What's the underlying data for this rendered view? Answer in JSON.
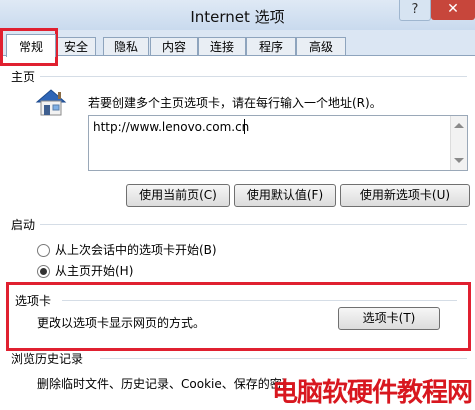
{
  "window": {
    "title": "Internet 选项",
    "help_label": "?",
    "close_label": "✕"
  },
  "tabs": [
    {
      "label": "常规",
      "active": true
    },
    {
      "label": "安全"
    },
    {
      "label": "隐私"
    },
    {
      "label": "内容"
    },
    {
      "label": "连接"
    },
    {
      "label": "程序"
    },
    {
      "label": "高级"
    }
  ],
  "homepage": {
    "section_label": "主页",
    "description": "若要创建多个主页选项卡，请在每行输入一个地址(R)。",
    "url_value": "http://www.lenovo.com.cn",
    "icon": "home-icon",
    "buttons": {
      "use_current": "使用当前页(C)",
      "use_default": "使用默认值(F)",
      "use_new_tab": "使用新选项卡(U)"
    }
  },
  "startup": {
    "section_label": "启动",
    "options": [
      {
        "label": "从上次会话中的选项卡开始(B)",
        "selected": false
      },
      {
        "label": "从主页开始(H)",
        "selected": true
      }
    ]
  },
  "tabs_section": {
    "section_label": "选项卡",
    "description": "更改以选项卡显示网页的方式。",
    "button_label": "选项卡(T)"
  },
  "history": {
    "section_label": "浏览历史记录",
    "description": "删除临时文件、历史记录、Cookie、保存的密码和网页表单信息。"
  },
  "watermark": "电脑软硬件教程网",
  "colors": {
    "highlight_box": "#e02030",
    "watermark": "#d8171f",
    "title_bar": "#c9daee"
  }
}
